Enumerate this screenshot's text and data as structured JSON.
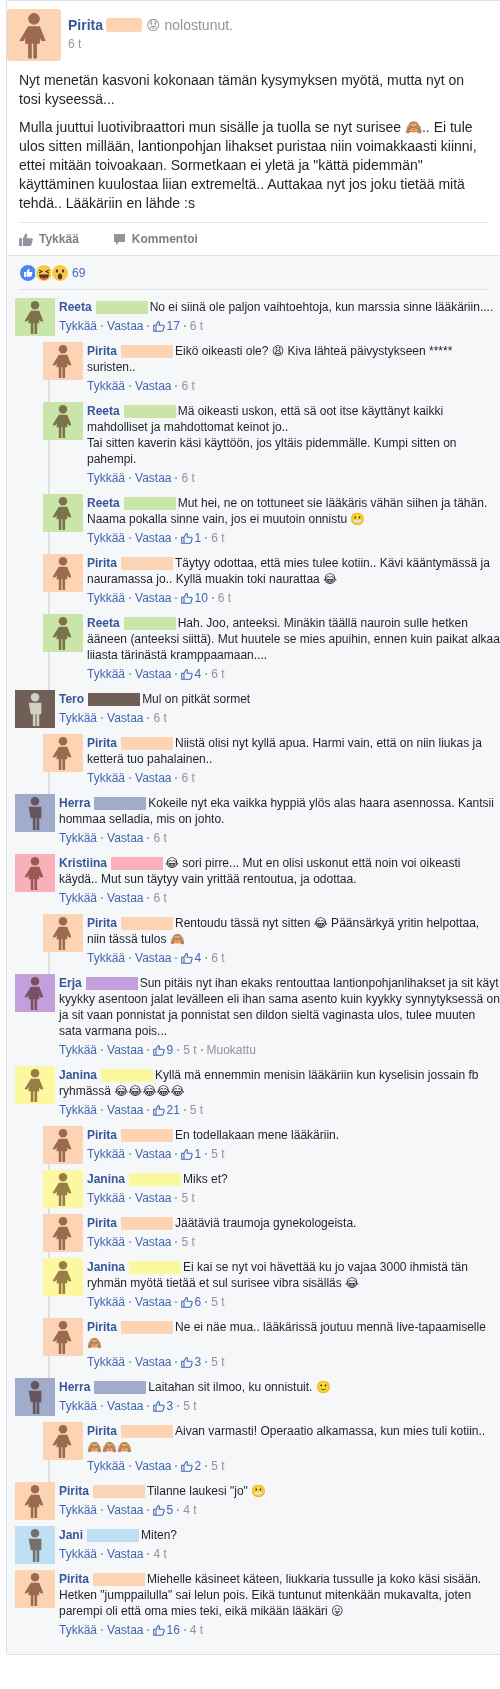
{
  "post": {
    "author": "Pirita",
    "color": "#fcd4b4",
    "kind": "female",
    "feeling": "😟 nolostunut.",
    "time": "6 t",
    "paragraphs": [
      "Nyt menetän kasvoni kokonaan tämän kysymyksen myötä, mutta nyt on tosi kyseessä...",
      "Mulla juuttui luotivibraattori mun sisälle ja tuolla se nyt surisee 🙈.. Ei tule ulos sitten millään, lantionpohjan lihakset puristaa niin voimakkaasti kiinni, ettei mitään toivoakaan. Sormetkaan ei yletä ja \"kättä pidemmän\" käyttäminen kuulostaa liian extremeltä.. Auttakaa nyt jos joku tietää mitä tehdä.. Lääkäriin en lähde :s"
    ],
    "like_button": "Tykkää",
    "comment_button": "Kommentoi"
  },
  "reactions": {
    "count": "69"
  },
  "comments": [
    {
      "author": "Reeta",
      "color": "#c9e5a7",
      "kind": "female",
      "text": "No ei siinä ole paljon vaihtoehtoja, kun marssia sinne lääkäriin....",
      "like": "Tykkää",
      "reply": "Vastaa",
      "likes": "17",
      "time": "6 t",
      "replies": [
        {
          "author": "Pirita",
          "color": "#fcd4b4",
          "kind": "female",
          "text": "Eikö oikeasti ole? 😩 Kiva lähteä päivystykseen ***** suristen..",
          "like": "Tykkää",
          "reply": "Vastaa",
          "time": "6 t"
        },
        {
          "author": "Reeta",
          "color": "#c9e5a7",
          "kind": "female",
          "text": "Mä oikeasti uskon, että sä oot itse käyttänyt kaikki mahdolliset ja mahdottomat keinot jo..\nTai sitten kaverin käsi käyttöön, jos yltäis pidemmälle. Kumpi sitten on pahempi.",
          "like": "Tykkää",
          "reply": "Vastaa",
          "time": "6 t"
        },
        {
          "author": "Reeta",
          "color": "#c9e5a7",
          "kind": "female",
          "text": "Mut hei, ne on tottuneet sie lääkäris vähän siihen ja tähän. Naama pokalla sinne vain, jos ei muutoin onnistu 😬",
          "like": "Tykkää",
          "reply": "Vastaa",
          "likes": "1",
          "time": "6 t"
        },
        {
          "author": "Pirita",
          "color": "#fcd4b4",
          "kind": "female",
          "text": "Täytyy odottaa, että mies tulee kotiin.. Kävi kääntymässä ja nauramassa jo.. Kyllä muakin toki naurattaa 😂",
          "like": "Tykkää",
          "reply": "Vastaa",
          "likes": "10",
          "time": "6 t"
        },
        {
          "author": "Reeta",
          "color": "#c9e5a7",
          "kind": "female",
          "text": "Hah. Joo, anteeksi. Minäkin täällä nauroin sulle hetken ääneen (anteeksi siittä). Mut huutele se mies apuihin, ennen kuin paikat alkaa liiasta tärinästä kramppaamaan....",
          "like": "Tykkää",
          "reply": "Vastaa",
          "likes": "4",
          "time": "6 t"
        }
      ]
    },
    {
      "author": "Tero",
      "color": "#6f5f56",
      "kind": "male",
      "text": "Mul on pitkät sormet",
      "like": "Tykkää",
      "reply": "Vastaa",
      "time": "6 t",
      "replies": [
        {
          "author": "Pirita",
          "color": "#fcd4b4",
          "kind": "female",
          "text": "Niistä olisi nyt kyllä apua. Harmi vain, että on niin liukas ja ketterä tuo pahalainen..",
          "like": "Tykkää",
          "reply": "Vastaa",
          "time": "6 t"
        }
      ]
    },
    {
      "author": "Herra",
      "color": "#a1abcc",
      "kind": "male",
      "text": "Kokeile nyt eka vaikka hyppiä ylös alas haara asennossa. Kantsii hommaa selladia, mis on johto.",
      "like": "Tykkää",
      "reply": "Vastaa",
      "time": "6 t"
    },
    {
      "author": "Kristiina",
      "color": "#f9b0bb",
      "kind": "female",
      "text": "😂 sori pirre... Mut en olisi uskonut että noin voi oikeasti käydä.. Mut sun täytyy vain yrittää rentoutua, ja odottaa.",
      "like": "Tykkää",
      "reply": "Vastaa",
      "time": "6 t",
      "replies": [
        {
          "author": "Pirita",
          "color": "#fcd4b4",
          "kind": "female",
          "text": "Rentoudu tässä nyt sitten 😂 Päänsärkyä yritin helpottaa, niin tässä tulos 🙈",
          "like": "Tykkää",
          "reply": "Vastaa",
          "likes": "4",
          "time": "6 t"
        }
      ]
    },
    {
      "author": "Erja",
      "color": "#c39fdc",
      "kind": "female",
      "text": "Sun pitäis nyt ihan ekaks rentouttaa lantionpohjanlihakset ja sit käyt kyykky asentoon jalat levälleen eli ihan sama asento kuin kyykky synnytyksessä on ja sit vaan ponnistat ja ponnistat sen dildon sieltä vaginasta ulos, tulee muuten sata varmana pois...",
      "like": "Tykkää",
      "reply": "Vastaa",
      "likes": "9",
      "time": "5 t",
      "edited": "Muokattu"
    },
    {
      "author": "Janina",
      "color": "#fbf8a0",
      "kind": "female",
      "text": "Kyllä mä ennemmin menisin lääkäriin kun kyselisin jossain fb ryhmässä 😂😂😂😂😂",
      "like": "Tykkää",
      "reply": "Vastaa",
      "likes": "21",
      "time": "5 t",
      "replies": [
        {
          "author": "Pirita",
          "color": "#fcd4b4",
          "kind": "female",
          "text": "En todellakaan mene lääkäriin.",
          "like": "Tykkää",
          "reply": "Vastaa",
          "likes": "1",
          "time": "5 t"
        },
        {
          "author": "Janina",
          "color": "#fbf8a0",
          "kind": "female",
          "text": "Miks et?",
          "like": "Tykkää",
          "reply": "Vastaa",
          "time": "5 t"
        },
        {
          "author": "Pirita",
          "color": "#fcd4b4",
          "kind": "female",
          "text": "Jäätäviä traumoja gynekologeista.",
          "like": "Tykkää",
          "reply": "Vastaa",
          "time": "5 t"
        },
        {
          "author": "Janina",
          "color": "#fbf8a0",
          "kind": "female",
          "text": "Ei kai se nyt voi hävettää ku jo vajaa 3000 ihmistä tän ryhmän myötä tietää et sul surisee vibra sisälläs 😂",
          "like": "Tykkää",
          "reply": "Vastaa",
          "likes": "6",
          "time": "5 t"
        },
        {
          "author": "Pirita",
          "color": "#fcd4b4",
          "kind": "female",
          "text": "Ne ei näe mua.. lääkärissä joutuu mennä live-tapaamiselle 🙈",
          "like": "Tykkää",
          "reply": "Vastaa",
          "likes": "3",
          "time": "5 t"
        }
      ]
    },
    {
      "author": "Herra",
      "color": "#a1abcc",
      "kind": "male",
      "text": "Laitahan sit ilmoo, ku onnistuit. 🙂",
      "like": "Tykkää",
      "reply": "Vastaa",
      "likes": "3",
      "time": "5 t",
      "replies": [
        {
          "author": "Pirita",
          "color": "#fcd4b4",
          "kind": "female",
          "text": "Aivan varmasti! Operaatio alkamassa, kun mies tuli kotiin.. 🙈🙈🙈",
          "like": "Tykkää",
          "reply": "Vastaa",
          "likes": "2",
          "time": "5 t"
        }
      ]
    },
    {
      "author": "Pirita",
      "color": "#fcd4b4",
      "kind": "female",
      "text": "Tilanne laukesi \"jo\" 😬",
      "like": "Tykkää",
      "reply": "Vastaa",
      "likes": "5",
      "time": "4 t"
    },
    {
      "author": "Jani",
      "color": "#bfe0f2",
      "kind": "male",
      "text": "Miten?",
      "like": "Tykkää",
      "reply": "Vastaa",
      "time": "4 t"
    },
    {
      "author": "Pirita",
      "color": "#fcd4b4",
      "kind": "female",
      "text": "Miehelle käsineet käteen, liukkaria tussulle ja koko käsi sisään. Hetken \"jumppailulla\" sai lelun pois. Eikä tuntunut mitenkään mukavalta, joten parempi oli että oma mies teki, eikä mikään lääkäri 😛",
      "like": "Tykkää",
      "reply": "Vastaa",
      "likes": "16",
      "time": "4 t"
    }
  ]
}
